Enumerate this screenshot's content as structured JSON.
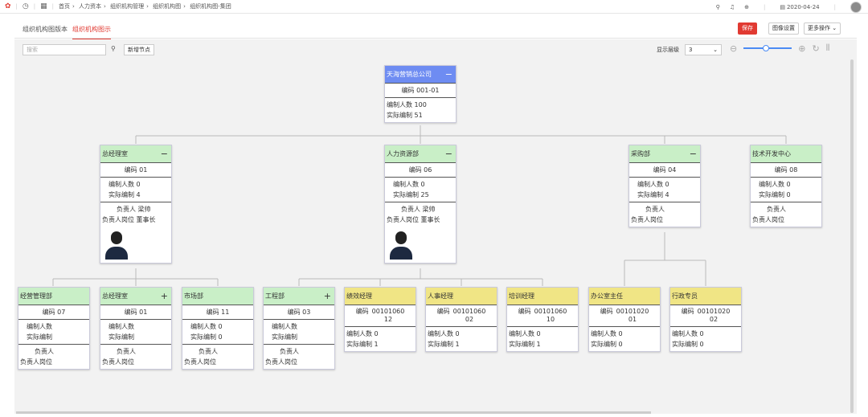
{
  "topbar": {
    "crumbs": [
      "首页",
      "人力资本",
      "组织机构管理",
      "组织机构图",
      "组织机构图-集团"
    ],
    "date": "2020-04-24"
  },
  "tabs": [
    "组织机构图版本",
    "组织机构图示"
  ],
  "actions": {
    "save": "保存",
    "image_settings": "图像设置",
    "more": "更多操作"
  },
  "toolbar": {
    "search_placeholder": "搜索",
    "add_node": "新增节点",
    "display_level_label": "显示层级",
    "display_level_value": "3",
    "zoom_level": 0.4
  },
  "labels": {
    "code": "编码",
    "planned": "编制人数",
    "actual": "实际编制",
    "head": "负责人",
    "head_pos": "负责人岗位"
  },
  "colors": {
    "root": "#6e8cf2",
    "dept": "#c9efc7",
    "position": "#f0e585",
    "accent": "#e13a32"
  },
  "nodes": {
    "root": {
      "name": "天海营销总公司",
      "code": "001-01",
      "planned": "100",
      "actual": "51",
      "toggle": "−"
    },
    "gm": {
      "name": "总经理室",
      "code": "01",
      "planned": "0",
      "actual": "4",
      "head": "梁帅",
      "head_pos": "董事长",
      "toggle": "−"
    },
    "hr": {
      "name": "人力资源部",
      "code": "06",
      "planned": "0",
      "actual": "25",
      "head": "梁帅",
      "head_pos": "董事长",
      "toggle": "−"
    },
    "purchase": {
      "name": "采购部",
      "code": "04",
      "planned": "0",
      "actual": "4",
      "toggle": "−"
    },
    "tech": {
      "name": "技术开发中心",
      "code": "08",
      "planned": "0",
      "actual": "0"
    },
    "ops": {
      "name": "经营管理部",
      "code": "07"
    },
    "gm2": {
      "name": "总经理室",
      "code": "01",
      "toggle": "+"
    },
    "market": {
      "name": "市场部",
      "code": "11",
      "planned": "0",
      "actual": "0"
    },
    "eng": {
      "name": "工程部",
      "code": "03",
      "toggle": "+"
    },
    "perf": {
      "name": "绩效经理",
      "code_a": "00101060",
      "code_b": "12",
      "planned": "0",
      "actual": "1"
    },
    "hrmgr": {
      "name": "人事经理",
      "code_a": "00101060",
      "code_b": "02",
      "planned": "0",
      "actual": "1"
    },
    "train": {
      "name": "培训经理",
      "code_a": "00101060",
      "code_b": "10",
      "planned": "0",
      "actual": "1"
    },
    "office": {
      "name": "办公室主任",
      "code_a": "00101020",
      "code_b": "01",
      "planned": "0",
      "actual": "0"
    },
    "admin": {
      "name": "行政专员",
      "code_a": "00101020",
      "code_b": "02",
      "planned": "0",
      "actual": "0"
    }
  }
}
